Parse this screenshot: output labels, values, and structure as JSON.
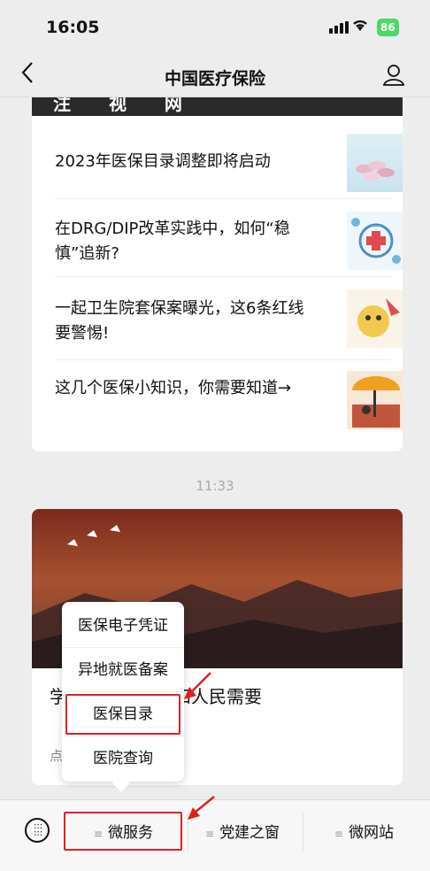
{
  "status": {
    "time": "16:05",
    "battery": "86"
  },
  "nav": {
    "title": "中国医疗保险"
  },
  "card1": {
    "header_text": "注 视 网",
    "articles": [
      {
        "title": "2023年医保目录调整即将启动"
      },
      {
        "title": "在DRG/DIP改革实践中，如何“稳慎”追新?"
      },
      {
        "title": "一起卫生院套保案曝光，这6条红线要警惕!"
      },
      {
        "title": "这几个医保小知识，你需要知道→"
      }
    ]
  },
  "time_separator": "11:33",
  "card2": {
    "title": "学习力成长为党和人民需要",
    "subtitle": "点 即可关注!"
  },
  "popup": {
    "items": [
      "医保电子凭证",
      "异地就医备案",
      "医保目录",
      "医院查询"
    ]
  },
  "tabbar": {
    "tabs": [
      "微服务",
      "党建之窗",
      "微网站"
    ]
  },
  "colors": {
    "highlight": "#e02020",
    "battery": "#4cd964"
  }
}
